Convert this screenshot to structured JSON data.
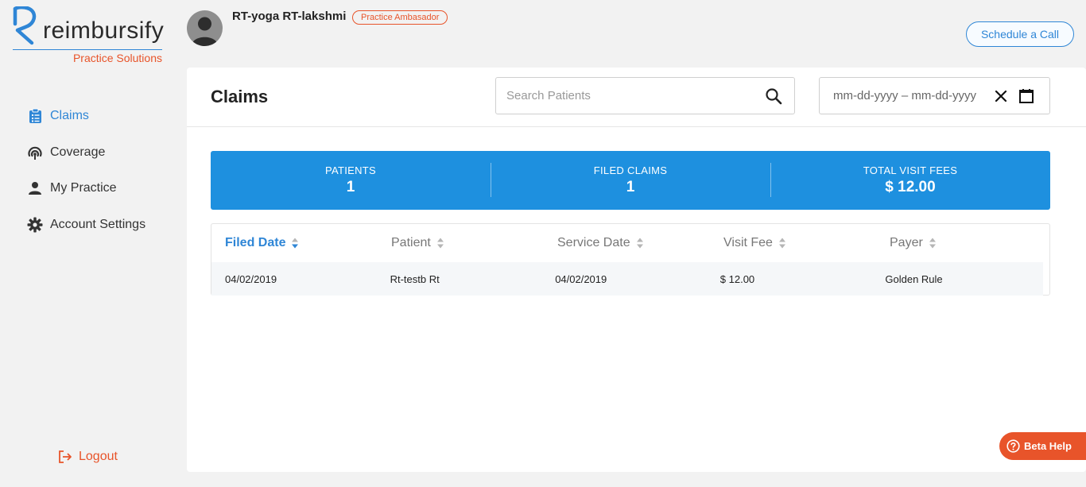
{
  "brand": {
    "name": "reimbursify",
    "tagline": "Practice Solutions"
  },
  "sidebar": {
    "items": [
      {
        "label": "Claims",
        "icon": "clipboard-icon",
        "active": true
      },
      {
        "label": "Coverage",
        "icon": "coverage-icon",
        "active": false
      },
      {
        "label": "My Practice",
        "icon": "person-icon",
        "active": false
      },
      {
        "label": "Account Settings",
        "icon": "gear-icon",
        "active": false
      }
    ],
    "logout_label": "Logout"
  },
  "header": {
    "user_name": "RT-yoga RT-lakshmi",
    "user_badge": "Practice Ambasador",
    "schedule_label": "Schedule a Call"
  },
  "main": {
    "title": "Claims",
    "search": {
      "placeholder": "Search Patients",
      "value": ""
    },
    "date_range": {
      "text": "mm-dd-yyyy – mm-dd-yyyy"
    },
    "stats": [
      {
        "label": "PATIENTS",
        "value": "1"
      },
      {
        "label": "FILED CLAIMS",
        "value": "1"
      },
      {
        "label": "TOTAL VISIT FEES",
        "value": "$ 12.00"
      }
    ],
    "table": {
      "columns": [
        "Filed Date",
        "Patient",
        "Service Date",
        "Visit Fee",
        "Payer"
      ],
      "rows": [
        [
          "04/02/2019",
          "Rt-testb Rt",
          "04/02/2019",
          "$ 12.00",
          "Golden Rule"
        ]
      ]
    }
  },
  "beta_help_label": "Beta Help",
  "colors": {
    "accent": "#2f86d6",
    "brand_orange": "#e8542a",
    "stats_bg": "#1e90df"
  }
}
